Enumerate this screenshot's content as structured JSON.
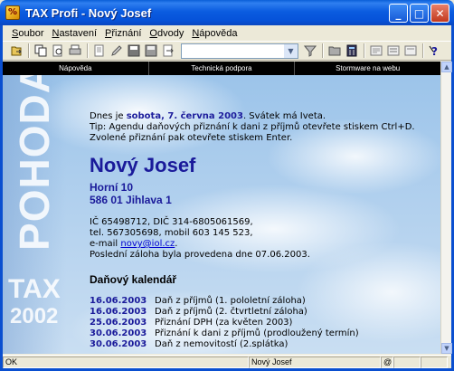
{
  "window": {
    "title": "TAX Profi - Nový Josef",
    "app_icon_glyph": "%",
    "controls": {
      "minimize": "_",
      "maximize": "□",
      "close": "✕"
    }
  },
  "menu": [
    "Soubor",
    "Nastavení",
    "Přiznání",
    "Odvody",
    "Nápověda"
  ],
  "toolbar": {
    "buttons": [
      "open-icon",
      "copy-icon",
      "print-preview-icon",
      "print-icon",
      "new-doc-icon",
      "edit-icon",
      "save-icon",
      "save-as-icon",
      "export-icon",
      "filter-icon",
      "folder-icon",
      "calculator-icon",
      "note-icon",
      "list-icon",
      "form-icon",
      "help-icon"
    ],
    "combo_value": ""
  },
  "links": [
    "Nápověda",
    "Technická podpora",
    "Stormware na webu"
  ],
  "logo": {
    "brand": "POHODA",
    "product": "TAX",
    "year": "2002"
  },
  "greeting": {
    "prefix": "Dnes je ",
    "date": "sobota, 7. června 2003",
    "suffix": ". Svátek má Iveta.",
    "tip_line1": "Tip: Agendu daňových přiznání k dani z příjmů otevřete stiskem Ctrl+D.",
    "tip_line2": "Zvolené přiznání pak otevřete stiskem Enter."
  },
  "contact": {
    "name": "Nový Josef",
    "street": "Horní 10",
    "city": "586 01 Jihlava 1",
    "ids": "IČ 65498712, DIČ 314-6805061569,",
    "phones": "tel. 567305698, mobil 603 145 523,",
    "email_prefix": "e-mail ",
    "email": "novy@iol.cz",
    "email_suffix": ".",
    "last_backup": "Poslední záloha byla provedena dne 07.06.2003."
  },
  "calendar": {
    "title": "Daňový kalendář",
    "items": [
      {
        "date": "16.06.2003",
        "text": "Daň z příjmů (1. pololetní záloha)"
      },
      {
        "date": "16.06.2003",
        "text": "Daň z příjmů (2. čtvrtletní záloha)"
      },
      {
        "date": "25.06.2003",
        "text": "Přiznání DPH (za květen 2003)"
      },
      {
        "date": "30.06.2003",
        "text": "Přiznání k dani z příjmů (prodloužený termín)"
      },
      {
        "date": "30.06.2003",
        "text": "Daň z nemovitostí (2.splátka)"
      }
    ]
  },
  "status": {
    "left": "OK",
    "user": "Nový Josef",
    "at": "@"
  },
  "colors": {
    "accent_blue": "#1a1a9a",
    "title_blue": "#0b5ce0",
    "link_bar": "#000000"
  }
}
